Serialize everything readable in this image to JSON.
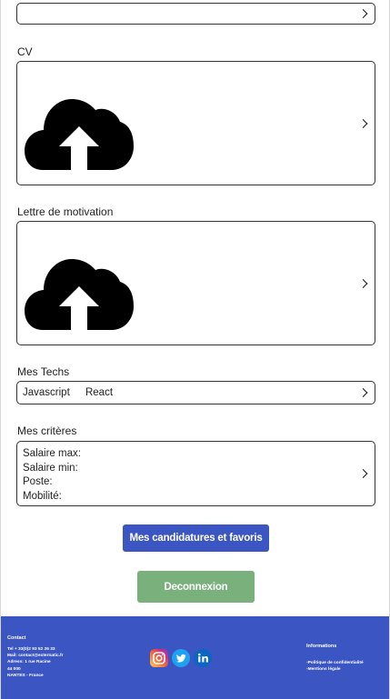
{
  "cv": {
    "label": "CV"
  },
  "cover_letter": {
    "label": "Lettre de motivation"
  },
  "techs": {
    "label": "Mes Techs",
    "items": [
      "Javascript",
      "React"
    ]
  },
  "criteria": {
    "label": "Mes critères",
    "lines": [
      "Salaire max:",
      "Salaire min:",
      "Poste:",
      "Mobilité:"
    ]
  },
  "buttons": {
    "applications": "Mes candidatures et favoris",
    "logout": "Deconnexion"
  },
  "footer": {
    "contact_title": "Contact",
    "contact_lines": [
      "Tel + 33(0)2 93 52 26 33",
      "Mail: contact@externatic.fr",
      "Adress: 1 rue Racine",
      "44 000",
      "NANTES - France"
    ],
    "info_title": "Informations",
    "info_lines": [
      "-Politique de confidentialité",
      "-Mentions légale"
    ],
    "socials": [
      "instagram-icon",
      "twitter-icon",
      "linkedin-icon"
    ]
  },
  "colors": {
    "primary": "#3b55c3",
    "secondary": "#79b07c",
    "footer": "#3b55c3"
  }
}
